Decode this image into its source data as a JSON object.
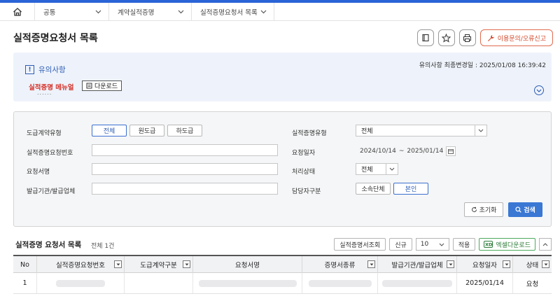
{
  "breadcrumb": {
    "home_icon": "home-icon",
    "items": [
      {
        "label": "공통"
      },
      {
        "label": "계약실적증명"
      },
      {
        "label": "실적증명요청서 목록"
      }
    ]
  },
  "page": {
    "title": "실적증명요청서 목록",
    "report_label": "이용문의/오류신고"
  },
  "notice": {
    "title": "유의사항",
    "updated_label": "유의사항 최종변경일 : 2025/01/08 16:39:42",
    "manual_label": "실적증명 메뉴얼",
    "manual_dots": "......",
    "download_label": "다운로드"
  },
  "search": {
    "contract_type_label": "도급계약유형",
    "contract_type_options": [
      "전체",
      "원도급",
      "하도급"
    ],
    "cert_type_label": "실적증명유형",
    "cert_type_value": "전체",
    "request_no_label": "실적증명요청번호",
    "request_date_label": "요청일자",
    "date_from": "2024/10/14",
    "date_sep": "~",
    "date_to": "2025/01/14",
    "request_name_label": "요청서명",
    "status_label": "처리상태",
    "status_value": "전체",
    "issuer_label": "발급기관/발급업체",
    "owner_label": "담당자구분",
    "owner_options": [
      "소속단체",
      "본인"
    ],
    "reset_label": "초기화",
    "search_label": "검색"
  },
  "list": {
    "title": "실적증명 요청서 목록",
    "count_label": "전체 1건",
    "lookup_label": "실적증명서조회",
    "new_label": "신규",
    "page_size": "10",
    "apply_label": "적용",
    "excel_label": "엑셀다운로드",
    "columns": [
      "No",
      "실적증명요청번호",
      "도급계약구분",
      "요청서명",
      "증명서종류",
      "발급기관/발급업체",
      "요청일자",
      "상태"
    ],
    "rows": [
      {
        "no": "1",
        "date": "2025/01/14",
        "status": "요청"
      }
    ]
  },
  "colors": {
    "accent": "#3a78d4",
    "notice_bg": "#eef3fb",
    "alert_red": "#d6322a"
  }
}
